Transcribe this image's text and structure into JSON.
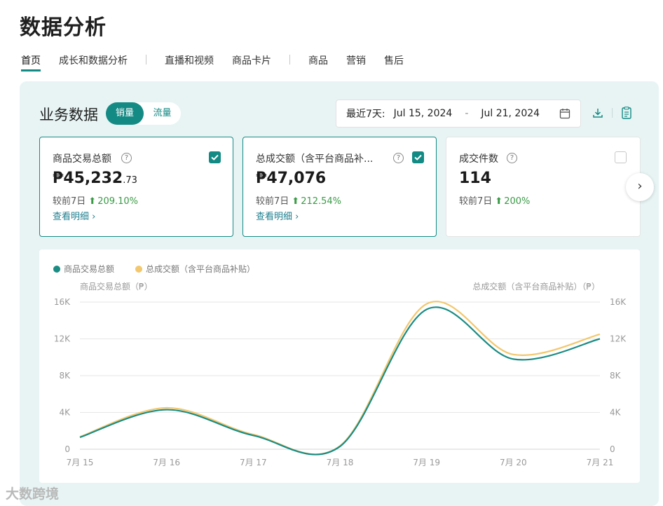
{
  "page": {
    "title": "数据分析"
  },
  "tabs": [
    {
      "label": "首页",
      "active": true
    },
    {
      "label": "成长和数据分析",
      "active": false
    },
    {
      "label": "直播和视频",
      "active": false
    },
    {
      "label": "商品卡片",
      "active": false
    },
    {
      "label": "商品",
      "active": false
    },
    {
      "label": "营销",
      "active": false
    },
    {
      "label": "售后",
      "active": false
    }
  ],
  "section": {
    "title": "业务数据",
    "toggle": {
      "on": "销量",
      "off": "流量"
    }
  },
  "date_range": {
    "label": "最近7天:",
    "start": "Jul 15, 2024",
    "separator": "-",
    "end": "Jul 21, 2024"
  },
  "icons": {
    "calendar": "calendar-icon",
    "download": "download-icon",
    "report": "document-icon",
    "next": "chevron-right-icon"
  },
  "cards": [
    {
      "title": "商品交易总额",
      "currency": "₱",
      "value": "45,232",
      "decimal": ".73",
      "compare_label": "较前7日",
      "change": "209.10%",
      "detail": "查看明细 ›",
      "checked": true
    },
    {
      "title": "总成交额（含平台商品补...",
      "currency": "₱",
      "value": "47,076",
      "decimal": "",
      "compare_label": "较前7日",
      "change": "212.54%",
      "detail": "查看明细 ›",
      "checked": true
    },
    {
      "title": "成交件数",
      "currency": "",
      "value": "114",
      "decimal": "",
      "compare_label": "较前7日",
      "change": "200%",
      "detail": "",
      "checked": false
    }
  ],
  "colors": {
    "accent": "#138a84",
    "series1": "#1a8c84",
    "series2": "#f2c76e",
    "positive": "#3a9a46",
    "panel_bg": "#e8f4f4"
  },
  "chart_data": {
    "type": "line",
    "x": [
      "7月 15",
      "7月 16",
      "7月 17",
      "7月 18",
      "7月 19",
      "7月 20",
      "7月 21"
    ],
    "series": [
      {
        "name": "商品交易总额",
        "values": [
          1300,
          4300,
          1500,
          300,
          15200,
          9800,
          12000
        ]
      },
      {
        "name": "总成交额（含平台商品补贴）",
        "values": [
          1350,
          4500,
          1600,
          350,
          15800,
          10300,
          12500
        ]
      }
    ],
    "ylabel_left": "商品交易总额（₱）",
    "ylabel_right": "总成交额（含平台商品补贴）（₱）",
    "yticks": [
      "0",
      "4K",
      "8K",
      "12K",
      "16K"
    ],
    "ylim": [
      0,
      16000
    ],
    "grid": true,
    "legend_position": "top-left",
    "smooth": true
  },
  "watermark": "大数跨境"
}
